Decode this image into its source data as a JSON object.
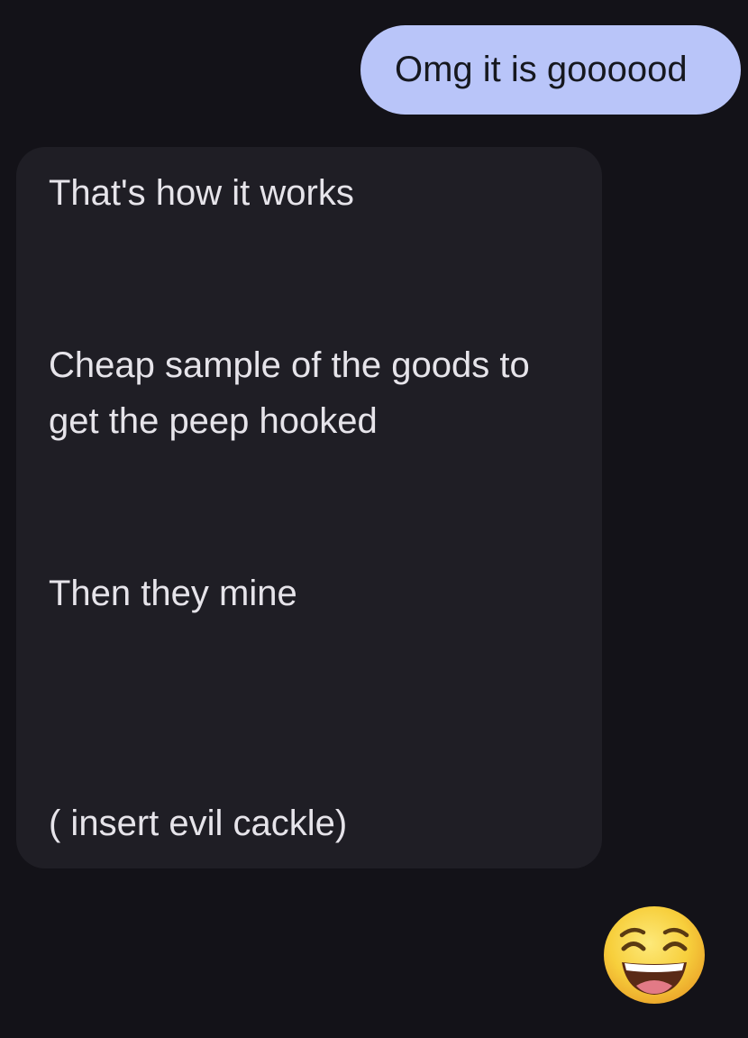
{
  "conversation": {
    "sent_message": "Omg it is goooood",
    "received_lines": [
      "That's how it works",
      "Cheap sample of the goods to",
      "get the peep hooked",
      "Then they mine",
      "( insert evil cackle)"
    ],
    "reply_emoji": "laughing-smiling-face-icon"
  },
  "colors": {
    "background": "#131218",
    "sent_bubble": "#b9c5f9",
    "received_bubble": "#1f1e25",
    "sent_text": "#16181f",
    "received_text": "#e6e4ea"
  }
}
